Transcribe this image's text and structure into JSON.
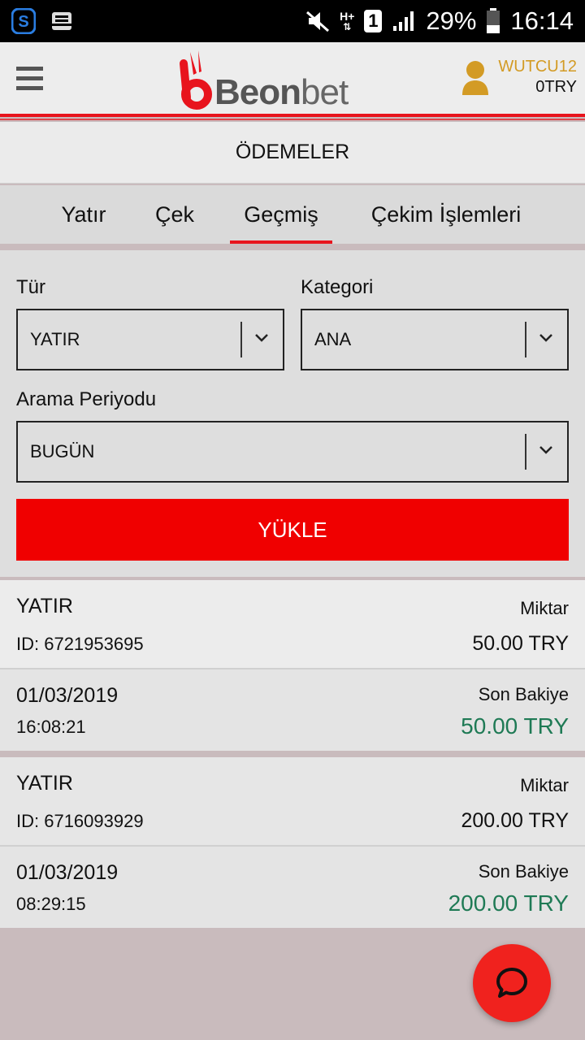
{
  "status_bar": {
    "battery": "29%",
    "time": "16:14",
    "sim_badge": "1",
    "network": "H+"
  },
  "header": {
    "logo_main": "Beon",
    "logo_suffix": "bet",
    "username": "WUTCU12",
    "balance": "0TRY",
    "accent_color": "#e8141d",
    "username_color": "#d39b25"
  },
  "page": {
    "title": "ÖDEMELER"
  },
  "tabs": [
    {
      "label": "Yatır",
      "active": false
    },
    {
      "label": "Çek",
      "active": false
    },
    {
      "label": "Geçmiş",
      "active": true
    },
    {
      "label": "Çekim İşlemleri",
      "active": false
    }
  ],
  "filters": {
    "type_label": "Tür",
    "type_value": "YATIR",
    "category_label": "Kategori",
    "category_value": "ANA",
    "period_label": "Arama Periyodu",
    "period_value": "BUGÜN",
    "load_button": "YÜKLE"
  },
  "transactions": [
    {
      "type": "YATIR",
      "id": "ID: 6721953695",
      "amount_label": "Miktar",
      "amount": "50.00 TRY",
      "date": "01/03/2019",
      "time": "16:08:21",
      "balance_label": "Son Bakiye",
      "balance": "50.00 TRY"
    },
    {
      "type": "YATIR",
      "id": "ID: 6716093929",
      "amount_label": "Miktar",
      "amount": "200.00 TRY",
      "date": "01/03/2019",
      "time": "08:29:15",
      "balance_label": "Son Bakiye",
      "balance": "200.00 TRY"
    }
  ],
  "icons": {
    "menu": "hamburger-icon",
    "user": "user-icon",
    "chat": "chat-icon",
    "dropdown": "chevron-down-icon"
  }
}
